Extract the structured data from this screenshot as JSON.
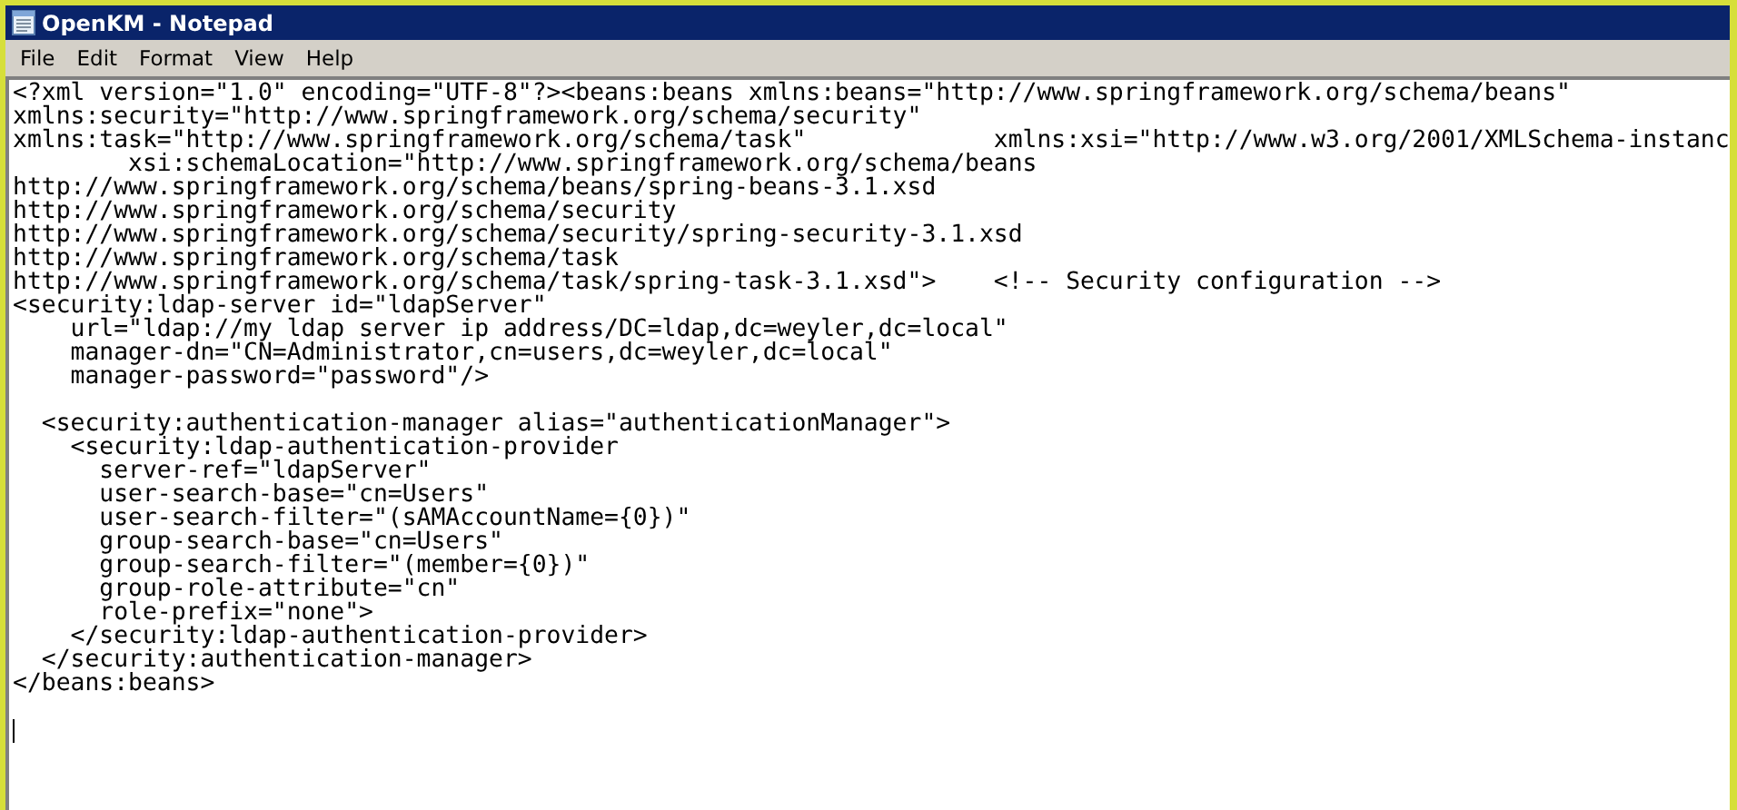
{
  "window": {
    "title": "OpenKM - Notepad"
  },
  "menu": [
    {
      "label": "File"
    },
    {
      "label": "Edit"
    },
    {
      "label": "Format"
    },
    {
      "label": "View"
    },
    {
      "label": "Help"
    }
  ],
  "editor": {
    "lines": [
      {
        "kind": "text",
        "text": "<?xml version=\"1.0\" encoding=\"UTF-8\"?><beans:beans xmlns:beans=\"http://www.springframework.org/schema/beans\""
      },
      {
        "kind": "text",
        "text": "xmlns:security=\"http://www.springframework.org/schema/security\""
      },
      {
        "kind": "text",
        "text": "xmlns:task=\"http://www.springframework.org/schema/task\"             xmlns:xsi=\"http://www.w3.org/2001/XMLSchema-instanc"
      },
      {
        "kind": "text",
        "text": "        xsi:schemaLocation=\"http://www.springframework.org/schema/beans"
      },
      {
        "kind": "text",
        "text": "http://www.springframework.org/schema/beans/spring-beans-3.1.xsd"
      },
      {
        "kind": "text",
        "text": "http://www.springframework.org/schema/security"
      },
      {
        "kind": "text",
        "text": "http://www.springframework.org/schema/security/spring-security-3.1.xsd"
      },
      {
        "kind": "text",
        "text": "http://www.springframework.org/schema/task"
      },
      {
        "kind": "text",
        "text": "http://www.springframework.org/schema/task/spring-task-3.1.xsd\">    <!-- Security configuration -->"
      },
      {
        "kind": "text",
        "text": "<security:ldap-server id=\"ldapServer\""
      },
      {
        "kind": "text",
        "text": "    url=\"ldap://my ldap server ip address/DC=ldap,dc=weyler,dc=local\""
      },
      {
        "kind": "text",
        "text": "    manager-dn=\"CN=Administrator,cn=users,dc=weyler,dc=local\""
      },
      {
        "kind": "text",
        "text": "    manager-password=\"password\"/>"
      },
      {
        "kind": "blank"
      },
      {
        "kind": "text",
        "text": "  <security:authentication-manager alias=\"authenticationManager\">"
      },
      {
        "kind": "text",
        "text": "    <security:ldap-authentication-provider"
      },
      {
        "kind": "text",
        "text": "      server-ref=\"ldapServer\""
      },
      {
        "kind": "text",
        "text": "      user-search-base=\"cn=Users\""
      },
      {
        "kind": "text",
        "text": "      user-search-filter=\"(sAMAccountName={0})\""
      },
      {
        "kind": "text",
        "text": "      group-search-base=\"cn=Users\""
      },
      {
        "kind": "text",
        "text": "      group-search-filter=\"(member={0})\""
      },
      {
        "kind": "text",
        "text": "      group-role-attribute=\"cn\""
      },
      {
        "kind": "text",
        "text": "      role-prefix=\"none\">"
      },
      {
        "kind": "text",
        "text": "    </security:ldap-authentication-provider>"
      },
      {
        "kind": "text",
        "text": "  </security:authentication-manager>"
      },
      {
        "kind": "text",
        "text": "</beans:beans>"
      },
      {
        "kind": "blank"
      },
      {
        "kind": "cursor"
      }
    ]
  }
}
